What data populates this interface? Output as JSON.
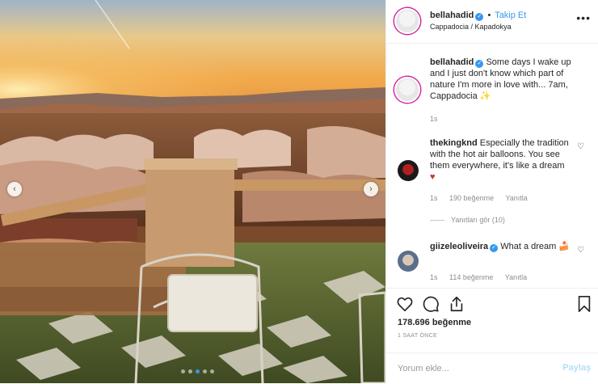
{
  "post": {
    "author": {
      "username": "bellahadid",
      "verified_icon": "verified-badge-icon",
      "follow_label": "Takip Et",
      "separator": "•",
      "location": "Cappadocia / Kapadokya"
    },
    "caption": {
      "username": "bellahadid",
      "text": "Some days I wake up and I just don't know which part of nature I'm more in love with... 7am, Cappadocia ",
      "emoji": "✨",
      "time": "1s"
    },
    "comments": [
      {
        "username": "thekingknd",
        "text": "Especially the tradition with the hot air balloons. You see them everywhere, it's like a dream ",
        "emoji": "♥",
        "time": "1s",
        "likes": "190 beğenme",
        "reply": "Yanıtla",
        "view_replies": "Yanıtları gör (10)"
      },
      {
        "username": "giizeleoliveira",
        "text": "What a dream ",
        "emoji": "🍰",
        "time": "1s",
        "likes": "114 beğenme",
        "reply": "Yanıtla"
      }
    ],
    "like_count": "178.696 beğenme",
    "posted_ago": "1 SAAT ÖNCE",
    "comment_placeholder": "Yorum ekle...",
    "share_label": "Paylaş",
    "more_label": "•••",
    "carousel": {
      "slide_count": 5,
      "active_slide": 2,
      "prev_glyph": "‹",
      "next_glyph": "›"
    },
    "icons": [
      "heart-icon",
      "comment-icon",
      "share-icon",
      "bookmark-icon",
      "more-options-icon"
    ]
  },
  "colors": {
    "accent": "#3897f0",
    "text": "#262626",
    "muted": "#8e8e8e",
    "share_disabled": "#b2dffc",
    "heart": "#c0392b"
  }
}
